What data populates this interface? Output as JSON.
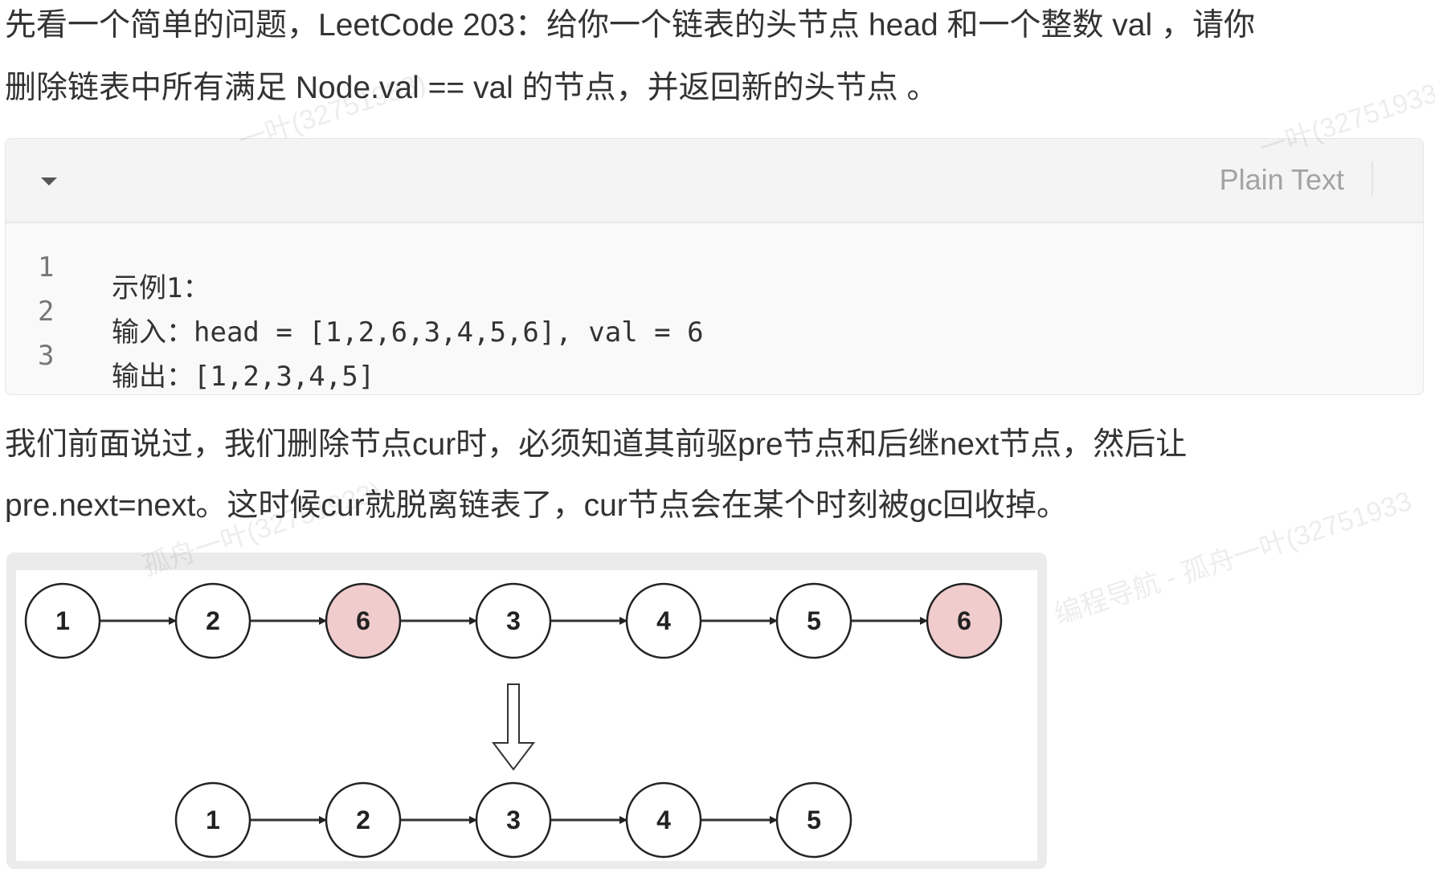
{
  "intro": {
    "line1": "先看一个简单的问题，LeetCode 203：给你一个链表的头节点 head 和一个整数 val ，请你",
    "line2": "删除链表中所有满足 Node.val == val 的节点，并返回新的头节点 。"
  },
  "code_block": {
    "language": "Plain Text",
    "collapse_icon": "chevron-down-icon",
    "lines": [
      {
        "number": "1",
        "text": "示例1："
      },
      {
        "number": "2",
        "text": "输入：head = [1,2,6,3,4,5,6], val = 6"
      },
      {
        "number": "3",
        "text": "输出：[1,2,3,4,5]"
      }
    ]
  },
  "explanation": {
    "line1": "我们前面说过，我们删除节点cur时，必须知道其前驱pre节点和后继next节点，然后让",
    "line2": "pre.next=next。这时候cur就脱离链表了，cur节点会在某个时刻被gc回收掉。"
  },
  "diagram": {
    "before": [
      {
        "label": "1",
        "removed": false
      },
      {
        "label": "2",
        "removed": false
      },
      {
        "label": "6",
        "removed": true
      },
      {
        "label": "3",
        "removed": false
      },
      {
        "label": "4",
        "removed": false
      },
      {
        "label": "5",
        "removed": false
      },
      {
        "label": "6",
        "removed": true
      }
    ],
    "after": [
      {
        "label": "1"
      },
      {
        "label": "2"
      },
      {
        "label": "3"
      },
      {
        "label": "4"
      },
      {
        "label": "5"
      }
    ],
    "removed_color": "#f0cccc",
    "node_color": "#ffffff"
  },
  "watermarks": [
    "一叶(32751933)",
    "一叶(32751933",
    "孤舟一叶(32751933)",
    "编程导航 - 孤舟一叶(32751933"
  ]
}
